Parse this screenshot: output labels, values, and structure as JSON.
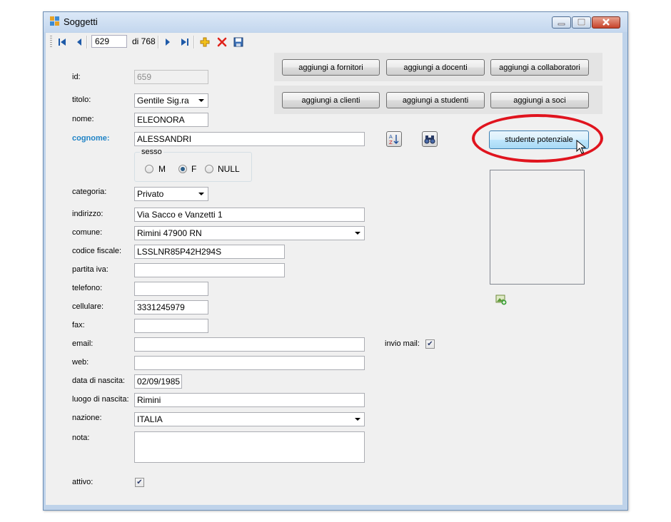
{
  "window": {
    "title": "Soggetti",
    "accent": "#bfd3ea"
  },
  "navigator": {
    "position": "629",
    "of_label": "di 768"
  },
  "buttons": {
    "add_fornitori": "aggiungi a fornitori",
    "add_docenti": "aggiungi a docenti",
    "add_collaboratori": "aggiungi a collaboratori",
    "add_clienti": "aggiungi a clienti",
    "add_studenti": "aggiungi a studenti",
    "add_soci": "aggiungi a soci",
    "studente_potenziale": "studente potenziale"
  },
  "form": {
    "id": {
      "label": "id:",
      "value": "659"
    },
    "titolo": {
      "label": "titolo:",
      "value": "Gentile Sig.ra"
    },
    "nome": {
      "label": "nome:",
      "value": "ELEONORA"
    },
    "cognome": {
      "label": "cognome:",
      "value": "ALESSANDRI"
    },
    "sesso": {
      "label": "sesso",
      "options": [
        "M",
        "F",
        "NULL"
      ],
      "selected": "F"
    },
    "categoria": {
      "label": "categoria:",
      "value": "Privato"
    },
    "indirizzo": {
      "label": "indirizzo:",
      "value": "Via Sacco e Vanzetti 1"
    },
    "comune": {
      "label": "comune:",
      "value": "Rimini 47900 RN"
    },
    "codice_fiscale": {
      "label": "codice fiscale:",
      "value": "LSSLNR85P42H294S"
    },
    "partita_iva": {
      "label": "partita iva:",
      "value": ""
    },
    "telefono": {
      "label": "telefono:",
      "value": ""
    },
    "cellulare": {
      "label": "cellulare:",
      "value": "3331245979"
    },
    "fax": {
      "label": "fax:",
      "value": ""
    },
    "email": {
      "label": "email:",
      "value": ""
    },
    "invio_mail": {
      "label": "invio mail:",
      "checked": true
    },
    "web": {
      "label": "web:",
      "value": ""
    },
    "data_nascita": {
      "label": "data di nascita:",
      "value": "02/09/1985"
    },
    "luogo_nascita": {
      "label": "luogo di nascita:",
      "value": "Rimini"
    },
    "nazione": {
      "label": "nazione:",
      "value": "ITALIA"
    },
    "nota": {
      "label": "nota:",
      "value": ""
    },
    "attivo": {
      "label": "attivo:",
      "checked": true
    }
  },
  "colors": {
    "cognome_label": "#1f83c6",
    "highlight_ellipse": "#e0141e"
  }
}
